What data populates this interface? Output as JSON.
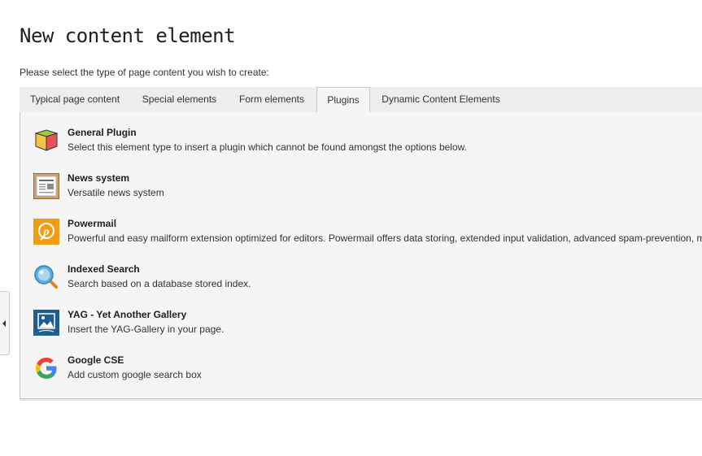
{
  "page": {
    "title": "New content element",
    "instruction": "Please select the type of page content you wish to create:"
  },
  "tabs": [
    {
      "label": "Typical page content",
      "active": false
    },
    {
      "label": "Special elements",
      "active": false
    },
    {
      "label": "Form elements",
      "active": false
    },
    {
      "label": "Plugins",
      "active": true
    },
    {
      "label": "Dynamic Content Elements",
      "active": false
    }
  ],
  "plugins": [
    {
      "name": "General Plugin",
      "description": "Select this element type to insert a plugin which cannot be found amongst the options below.",
      "icon": "cube-icon"
    },
    {
      "name": "News system",
      "description": "Versatile news system",
      "icon": "newspaper-icon"
    },
    {
      "name": "Powermail",
      "description": "Powerful and easy mailform extension optimized for editors. Powermail offers data storing, extended input validation, advanced spam-prevention, ma",
      "icon": "powermail-icon"
    },
    {
      "name": "Indexed Search",
      "description": "Search based on a database stored index.",
      "icon": "magnifier-icon"
    },
    {
      "name": "YAG - Yet Another Gallery",
      "description": "Insert the YAG-Gallery in your page.",
      "icon": "gallery-icon"
    },
    {
      "name": "Google CSE",
      "description": "Add custom google search box",
      "icon": "google-icon"
    }
  ],
  "sidebar_toggle": {
    "icon": "caret-left-icon"
  },
  "colors": {
    "tab_bar": "#ededed",
    "panel": "#f5f5f5",
    "border": "#c8c8c8",
    "powermail_orange": "#f39c12",
    "yag_blue": "#1f5f8b"
  }
}
